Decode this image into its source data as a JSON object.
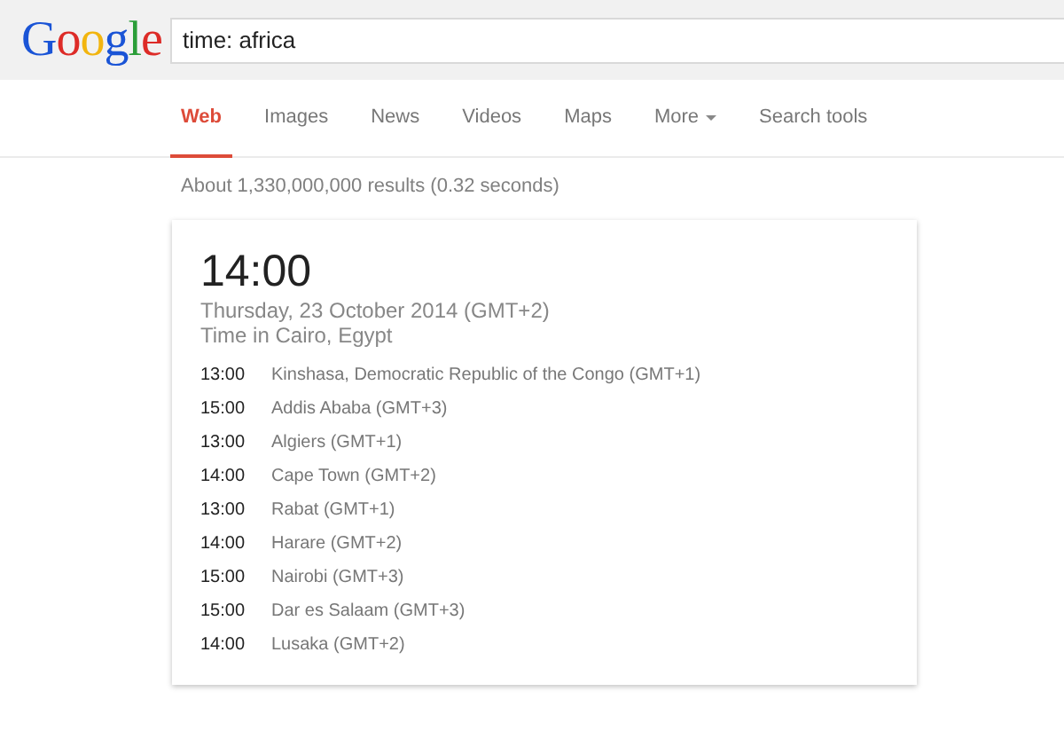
{
  "header": {
    "logo": "Google",
    "search": {
      "value": "time: africa"
    }
  },
  "tabs": [
    {
      "label": "Web",
      "selected": true,
      "has_menu": false
    },
    {
      "label": "Images",
      "selected": false,
      "has_menu": false
    },
    {
      "label": "News",
      "selected": false,
      "has_menu": false
    },
    {
      "label": "Videos",
      "selected": false,
      "has_menu": false
    },
    {
      "label": "Maps",
      "selected": false,
      "has_menu": false
    },
    {
      "label": "More",
      "selected": false,
      "has_menu": true
    },
    {
      "label": "Search tools",
      "selected": false,
      "has_menu": false
    }
  ],
  "result_stats": "About 1,330,000,000 results (0.32 seconds)",
  "time_card": {
    "time": "14:00",
    "date": "Thursday, 23 October 2014 (GMT+2)",
    "location": "Time in Cairo, Egypt",
    "cities": [
      {
        "time": "13:00",
        "place": "Kinshasa, Democratic Republic of the Congo (GMT+1)"
      },
      {
        "time": "15:00",
        "place": "Addis Ababa (GMT+3)"
      },
      {
        "time": "13:00",
        "place": "Algiers (GMT+1)"
      },
      {
        "time": "14:00",
        "place": "Cape Town (GMT+2)"
      },
      {
        "time": "13:00",
        "place": "Rabat (GMT+1)"
      },
      {
        "time": "14:00",
        "place": "Harare (GMT+2)"
      },
      {
        "time": "15:00",
        "place": "Nairobi (GMT+3)"
      },
      {
        "time": "15:00",
        "place": "Dar es Salaam (GMT+3)"
      },
      {
        "time": "14:00",
        "place": "Lusaka (GMT+2)"
      }
    ]
  }
}
